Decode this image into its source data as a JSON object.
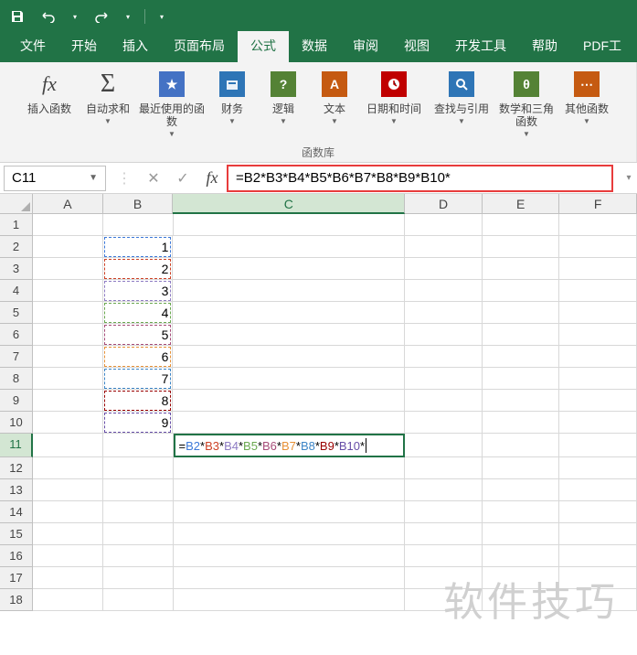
{
  "titlebar": {
    "save_icon": "save-icon",
    "undo_icon": "undo-icon",
    "redo_icon": "redo-icon"
  },
  "tabs": {
    "file": "文件",
    "home": "开始",
    "insert": "插入",
    "layout": "页面布局",
    "formulas": "公式",
    "data": "数据",
    "review": "审阅",
    "view": "视图",
    "dev": "开发工具",
    "help": "帮助",
    "pdf": "PDF工"
  },
  "ribbon": {
    "insert_fn": "插入函数",
    "autosum": "自动求和",
    "recent": "最近使用的函数",
    "financial": "财务",
    "logical": "逻辑",
    "text": "文本",
    "datetime": "日期和时间",
    "lookup": "查找与引用",
    "math": "数学和三角函数",
    "more": "其他函数",
    "group_label": "函数库"
  },
  "namebox": "C11",
  "formula": "=B2*B3*B4*B5*B6*B7*B8*B9*B10*",
  "columns": [
    "A",
    "B",
    "C",
    "D",
    "E",
    "F"
  ],
  "rows": [
    "1",
    "2",
    "3",
    "4",
    "5",
    "6",
    "7",
    "8",
    "9",
    "10",
    "11",
    "12",
    "13",
    "14",
    "15",
    "16",
    "17",
    "18"
  ],
  "data_b": {
    "2": "1",
    "3": "2",
    "4": "3",
    "5": "4",
    "6": "5",
    "7": "6",
    "8": "7",
    "9": "8",
    "10": "9"
  },
  "ref_colors": {
    "2": "#3c78d8",
    "3": "#cc4125",
    "4": "#8e7cc3",
    "5": "#6aa84f",
    "6": "#a64d79",
    "7": "#e69138",
    "8": "#3d85c6",
    "9": "#990000",
    "10": "#674ea7"
  },
  "formula_tokens": [
    {
      "t": "=",
      "c": "#000"
    },
    {
      "t": "B2",
      "c": "#3c78d8"
    },
    {
      "t": "*",
      "c": "#000"
    },
    {
      "t": "B3",
      "c": "#cc4125"
    },
    {
      "t": "*",
      "c": "#000"
    },
    {
      "t": "B4",
      "c": "#8e7cc3"
    },
    {
      "t": "*",
      "c": "#000"
    },
    {
      "t": "B5",
      "c": "#6aa84f"
    },
    {
      "t": "*",
      "c": "#000"
    },
    {
      "t": "B6",
      "c": "#a64d79"
    },
    {
      "t": "*",
      "c": "#000"
    },
    {
      "t": "B7",
      "c": "#e69138"
    },
    {
      "t": "*",
      "c": "#000"
    },
    {
      "t": "B8",
      "c": "#3d85c6"
    },
    {
      "t": "*",
      "c": "#000"
    },
    {
      "t": "B9",
      "c": "#990000"
    },
    {
      "t": "*",
      "c": "#000"
    },
    {
      "t": "B10",
      "c": "#674ea7"
    },
    {
      "t": "*",
      "c": "#000"
    }
  ],
  "watermark": "软件技巧"
}
